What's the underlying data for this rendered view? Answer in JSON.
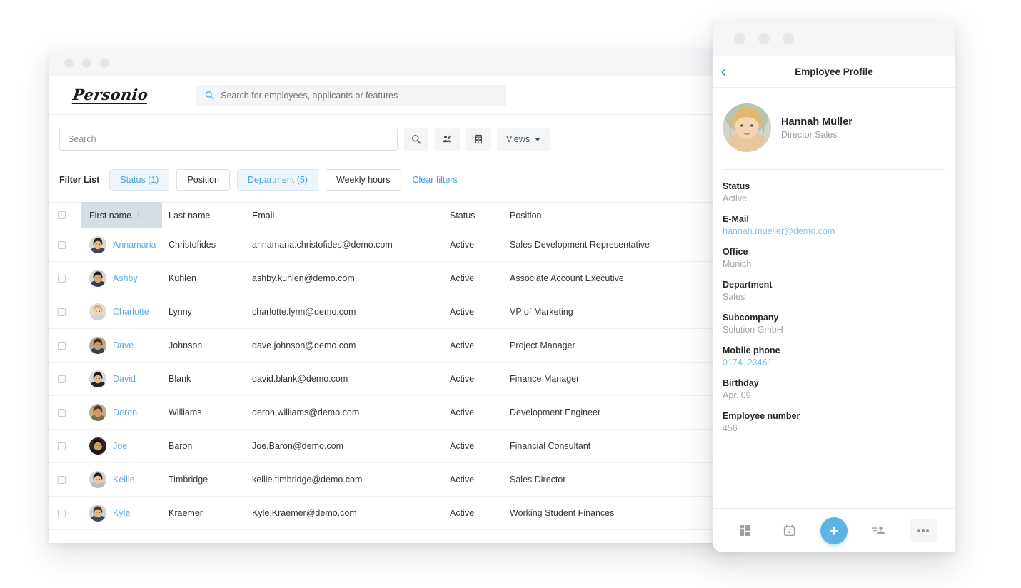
{
  "desktop": {
    "window_controls": [
      "close",
      "minimize",
      "maximize"
    ],
    "brand": "Personio",
    "global_search": {
      "placeholder": "Search for employees, applicants or features",
      "value": "",
      "icon": "search-icon"
    },
    "toolbar": {
      "search": {
        "placeholder": "Search",
        "value": ""
      },
      "search_button_icon": "search-icon",
      "people_settings_icon": "people-settings-icon",
      "columns_icon": "columns-document-icon",
      "views_label": "Views"
    },
    "filters": {
      "label": "Filter List",
      "chips": [
        {
          "label": "Status (1)",
          "active": true
        },
        {
          "label": "Position",
          "active": false
        },
        {
          "label": "Department (5)",
          "active": true
        },
        {
          "label": "Weekly hours",
          "active": false
        }
      ],
      "clear_label": "Clear filters"
    },
    "table": {
      "columns": [
        "First name",
        "Last name",
        "Email",
        "Status",
        "Position"
      ],
      "sorted_column": "First name",
      "sort_direction": "ascending",
      "sort_glyph": "↑",
      "rows": [
        {
          "first": "Annamaria",
          "last": "Christofides",
          "email": "annamaria.christofides@demo.com",
          "status": "Active",
          "position": "Sales Development Representative"
        },
        {
          "first": "Ashby",
          "last": "Kuhlen",
          "email": "ashby.kuhlen@demo.com",
          "status": "Active",
          "position": "Associate Account Executive"
        },
        {
          "first": "Charlotte",
          "last": "Lynny",
          "email": "charlotte.lynn@demo.com",
          "status": "Active",
          "position": "VP of Marketing"
        },
        {
          "first": "Dave",
          "last": "Johnson",
          "email": "dave.johnson@demo.com",
          "status": "Active",
          "position": "Project Manager"
        },
        {
          "first": "David",
          "last": "Blank",
          "email": "david.blank@demo.com",
          "status": "Active",
          "position": "Finance Manager"
        },
        {
          "first": "Deron",
          "last": "Williams",
          "email": "deron.williams@demo.com",
          "status": "Active",
          "position": "Development Engineer"
        },
        {
          "first": "Joe",
          "last": "Baron",
          "email": "Joe.Baron@demo.com",
          "status": "Active",
          "position": "Financial Consultant"
        },
        {
          "first": "Kellie",
          "last": "Timbridge",
          "email": "kellie.timbridge@demo.com",
          "status": "Active",
          "position": "Sales Director"
        },
        {
          "first": "Kyle",
          "last": "Kraemer",
          "email": "Kyle.Kraemer@demo.com",
          "status": "Active",
          "position": "Working Student Finances"
        }
      ]
    }
  },
  "mobile": {
    "window_controls": [
      "close",
      "minimize",
      "maximize"
    ],
    "back_glyph": "‹",
    "title": "Employee Profile",
    "profile": {
      "name": "Hannah Müller",
      "role": "Director Sales"
    },
    "fields": [
      {
        "label": "Status",
        "value": "Active",
        "link": false
      },
      {
        "label": "E-Mail",
        "value": "hannah.mueller@demo.com",
        "link": true
      },
      {
        "label": "Office",
        "value": "Munich",
        "link": false
      },
      {
        "label": "Department",
        "value": "Sales",
        "link": false
      },
      {
        "label": "Subcompany",
        "value": "Solution GmbH",
        "link": false
      },
      {
        "label": "Mobile phone",
        "value": "0174123461",
        "link": true
      },
      {
        "label": "Birthday",
        "value": "Apr. 09",
        "link": false
      },
      {
        "label": "Employee number",
        "value": "456",
        "link": false
      }
    ],
    "tabbar": [
      {
        "icon": "dashboard-grid-icon",
        "boxed": false
      },
      {
        "icon": "calendar-icon",
        "boxed": false
      },
      {
        "icon": "add-plus-icon",
        "fab": true
      },
      {
        "icon": "people-list-icon",
        "boxed": false
      },
      {
        "icon": "more-ellipsis-icon",
        "boxed": true
      }
    ]
  },
  "colors": {
    "accent_blue": "#5cb4e4",
    "link_blue": "#60afe0",
    "back_blue": "#1a6fd4",
    "chip_active_bg": "#eef6fb",
    "sorted_header_bg": "#d4dee3"
  }
}
